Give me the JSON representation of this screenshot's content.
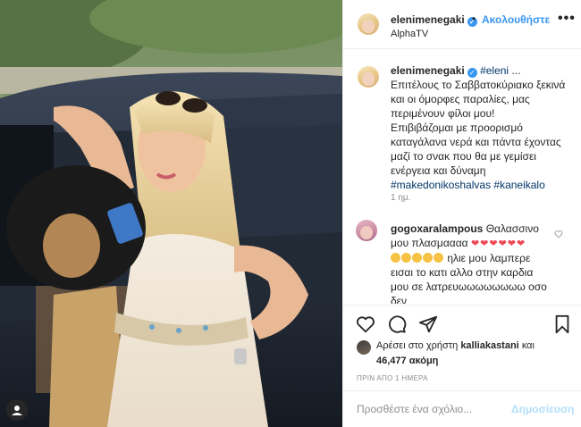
{
  "header": {
    "username": "elenimenegaki",
    "separator": "•",
    "follow_label": "Ακολουθήστε",
    "location": "AlphaTV",
    "more": "•••"
  },
  "caption": {
    "username": "elenimenegaki",
    "mention": "#eleni",
    "line1": " ... Επιτέλους το Σαββατοκύριακο ξεκινά και οι όμορφες παραλίες, μας περιμένουν φίλοι μου!",
    "line2": "Επιβιβάζομαι με προορισμό καταγάλανα νερά και πάντα έχοντας μαζί το σνακ που θα με γεμίσει ενέργεια και δύναμη",
    "tags": "#makedonikoshalvas #kaneikalo",
    "time": "1 ημ."
  },
  "comment": {
    "username": "gogoxaralampous",
    "text1": " Θαλασσινο μου πλασμαααα",
    "hearts": "❤❤❤❤❤❤",
    "text2": "ηλιε μου λαμπερε εισαι το κατι αλλο στην καρδια μου σε λατρευωωωωωωωω οσο δεν"
  },
  "likes": {
    "prefix": "Αρέσει στο χρήστη",
    "user": "kalliakastani",
    "conj": "και",
    "count": "46,477 ακόμη"
  },
  "timestamp": "ΠΡΙΝ ΑΠΟ 1 ΗΜΕΡΑ",
  "add_comment": {
    "placeholder": "Προσθέστε ένα σχόλιο...",
    "post_label": "Δημοσίευση"
  },
  "colors": {
    "accent": "#3897f0",
    "heart": "#ed4956",
    "muted": "#8e8e8e"
  }
}
